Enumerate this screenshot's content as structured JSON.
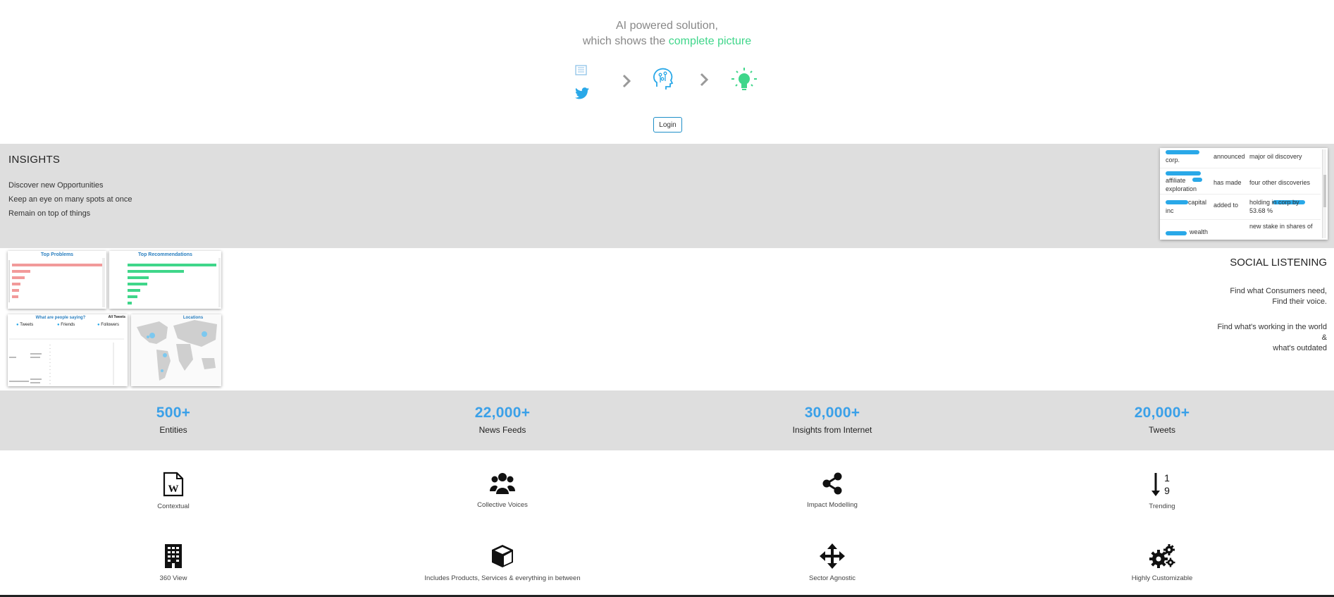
{
  "hero": {
    "line1": "AI powered solution,",
    "line2_prefix": "which shows the ",
    "line2_highlight": "complete picture",
    "login_label": "Login"
  },
  "insights": {
    "title": "INSIGHTS",
    "items": [
      "Discover new Opportunities",
      "Keep an eye on many spots at once",
      "Remain on top of things"
    ],
    "table_rows": [
      {
        "subject": "corp.",
        "relation": "announced",
        "object": "major oil discovery"
      },
      {
        "subject": "affiliate exploration",
        "relation": "has made",
        "object": "four other discoveries"
      },
      {
        "subject": "capital inc",
        "relation": "added to",
        "object": "holding in corp by 53.68 %"
      },
      {
        "subject": "wealth",
        "relation": "",
        "object": "new stake in shares of"
      }
    ]
  },
  "social": {
    "title": "SOCIAL LISTENING",
    "lines": [
      "Find what Consumers need,",
      "Find their voice.",
      "Find what's working in the world",
      "&",
      "what's outdated"
    ],
    "panels": {
      "top_problems": "Top Problems",
      "top_recommendations": "Top Recommendations",
      "people_saying": "What are people saying?",
      "all_tweets": "All Tweets",
      "tweets": "Tweets",
      "friends": "Friends",
      "followers": "Followers",
      "locations": "Locations"
    }
  },
  "stats": [
    {
      "number": "500+",
      "label": "Entities"
    },
    {
      "number": "22,000+",
      "label": "News Feeds"
    },
    {
      "number": "30,000+",
      "label": "Insights from Internet"
    },
    {
      "number": "20,000+",
      "label": "Tweets"
    }
  ],
  "features": [
    {
      "label": "Contextual",
      "icon": "word-document-icon"
    },
    {
      "label": "Collective Voices",
      "icon": "users-icon"
    },
    {
      "label": "Impact Modelling",
      "icon": "share-icon"
    },
    {
      "label": "Trending",
      "icon": "sort-numeric-icon"
    },
    {
      "label": "360 View",
      "icon": "building-icon"
    },
    {
      "label": "Includes Products, Services & everything in between",
      "icon": "cube-icon"
    },
    {
      "label": "Sector Agnostic",
      "icon": "move-arrows-icon"
    },
    {
      "label": "Highly Customizable",
      "icon": "gears-icon"
    }
  ],
  "colors": {
    "accent_green": "#3fd68a",
    "accent_blue": "#3aa0e8",
    "twitter_blue": "#29a8e8",
    "section_gray": "#dedede"
  }
}
